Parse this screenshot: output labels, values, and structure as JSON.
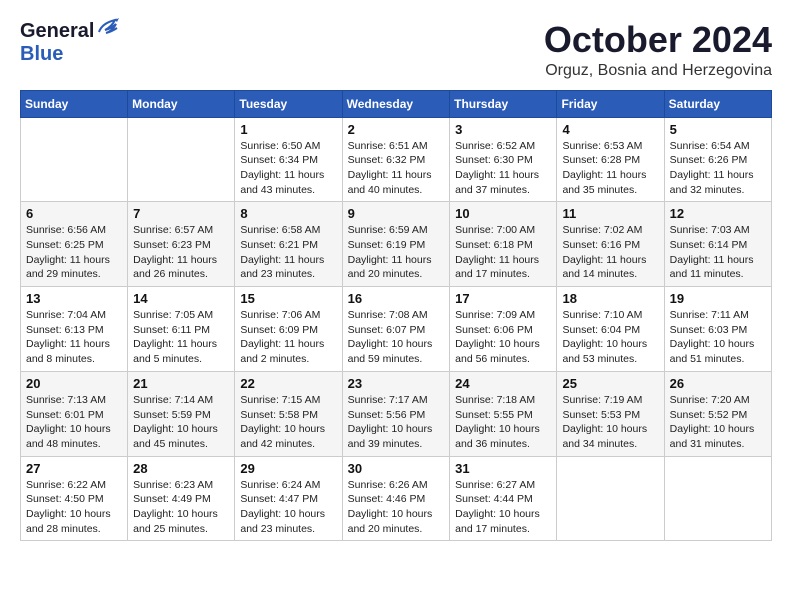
{
  "header": {
    "logo_general": "General",
    "logo_blue": "Blue",
    "month": "October 2024",
    "location": "Orguz, Bosnia and Herzegovina"
  },
  "days_of_week": [
    "Sunday",
    "Monday",
    "Tuesday",
    "Wednesday",
    "Thursday",
    "Friday",
    "Saturday"
  ],
  "weeks": [
    [
      {
        "day": "",
        "info": ""
      },
      {
        "day": "",
        "info": ""
      },
      {
        "day": "1",
        "info": "Sunrise: 6:50 AM\nSunset: 6:34 PM\nDaylight: 11 hours and 43 minutes."
      },
      {
        "day": "2",
        "info": "Sunrise: 6:51 AM\nSunset: 6:32 PM\nDaylight: 11 hours and 40 minutes."
      },
      {
        "day": "3",
        "info": "Sunrise: 6:52 AM\nSunset: 6:30 PM\nDaylight: 11 hours and 37 minutes."
      },
      {
        "day": "4",
        "info": "Sunrise: 6:53 AM\nSunset: 6:28 PM\nDaylight: 11 hours and 35 minutes."
      },
      {
        "day": "5",
        "info": "Sunrise: 6:54 AM\nSunset: 6:26 PM\nDaylight: 11 hours and 32 minutes."
      }
    ],
    [
      {
        "day": "6",
        "info": "Sunrise: 6:56 AM\nSunset: 6:25 PM\nDaylight: 11 hours and 29 minutes."
      },
      {
        "day": "7",
        "info": "Sunrise: 6:57 AM\nSunset: 6:23 PM\nDaylight: 11 hours and 26 minutes."
      },
      {
        "day": "8",
        "info": "Sunrise: 6:58 AM\nSunset: 6:21 PM\nDaylight: 11 hours and 23 minutes."
      },
      {
        "day": "9",
        "info": "Sunrise: 6:59 AM\nSunset: 6:19 PM\nDaylight: 11 hours and 20 minutes."
      },
      {
        "day": "10",
        "info": "Sunrise: 7:00 AM\nSunset: 6:18 PM\nDaylight: 11 hours and 17 minutes."
      },
      {
        "day": "11",
        "info": "Sunrise: 7:02 AM\nSunset: 6:16 PM\nDaylight: 11 hours and 14 minutes."
      },
      {
        "day": "12",
        "info": "Sunrise: 7:03 AM\nSunset: 6:14 PM\nDaylight: 11 hours and 11 minutes."
      }
    ],
    [
      {
        "day": "13",
        "info": "Sunrise: 7:04 AM\nSunset: 6:13 PM\nDaylight: 11 hours and 8 minutes."
      },
      {
        "day": "14",
        "info": "Sunrise: 7:05 AM\nSunset: 6:11 PM\nDaylight: 11 hours and 5 minutes."
      },
      {
        "day": "15",
        "info": "Sunrise: 7:06 AM\nSunset: 6:09 PM\nDaylight: 11 hours and 2 minutes."
      },
      {
        "day": "16",
        "info": "Sunrise: 7:08 AM\nSunset: 6:07 PM\nDaylight: 10 hours and 59 minutes."
      },
      {
        "day": "17",
        "info": "Sunrise: 7:09 AM\nSunset: 6:06 PM\nDaylight: 10 hours and 56 minutes."
      },
      {
        "day": "18",
        "info": "Sunrise: 7:10 AM\nSunset: 6:04 PM\nDaylight: 10 hours and 53 minutes."
      },
      {
        "day": "19",
        "info": "Sunrise: 7:11 AM\nSunset: 6:03 PM\nDaylight: 10 hours and 51 minutes."
      }
    ],
    [
      {
        "day": "20",
        "info": "Sunrise: 7:13 AM\nSunset: 6:01 PM\nDaylight: 10 hours and 48 minutes."
      },
      {
        "day": "21",
        "info": "Sunrise: 7:14 AM\nSunset: 5:59 PM\nDaylight: 10 hours and 45 minutes."
      },
      {
        "day": "22",
        "info": "Sunrise: 7:15 AM\nSunset: 5:58 PM\nDaylight: 10 hours and 42 minutes."
      },
      {
        "day": "23",
        "info": "Sunrise: 7:17 AM\nSunset: 5:56 PM\nDaylight: 10 hours and 39 minutes."
      },
      {
        "day": "24",
        "info": "Sunrise: 7:18 AM\nSunset: 5:55 PM\nDaylight: 10 hours and 36 minutes."
      },
      {
        "day": "25",
        "info": "Sunrise: 7:19 AM\nSunset: 5:53 PM\nDaylight: 10 hours and 34 minutes."
      },
      {
        "day": "26",
        "info": "Sunrise: 7:20 AM\nSunset: 5:52 PM\nDaylight: 10 hours and 31 minutes."
      }
    ],
    [
      {
        "day": "27",
        "info": "Sunrise: 6:22 AM\nSunset: 4:50 PM\nDaylight: 10 hours and 28 minutes."
      },
      {
        "day": "28",
        "info": "Sunrise: 6:23 AM\nSunset: 4:49 PM\nDaylight: 10 hours and 25 minutes."
      },
      {
        "day": "29",
        "info": "Sunrise: 6:24 AM\nSunset: 4:47 PM\nDaylight: 10 hours and 23 minutes."
      },
      {
        "day": "30",
        "info": "Sunrise: 6:26 AM\nSunset: 4:46 PM\nDaylight: 10 hours and 20 minutes."
      },
      {
        "day": "31",
        "info": "Sunrise: 6:27 AM\nSunset: 4:44 PM\nDaylight: 10 hours and 17 minutes."
      },
      {
        "day": "",
        "info": ""
      },
      {
        "day": "",
        "info": ""
      }
    ]
  ]
}
